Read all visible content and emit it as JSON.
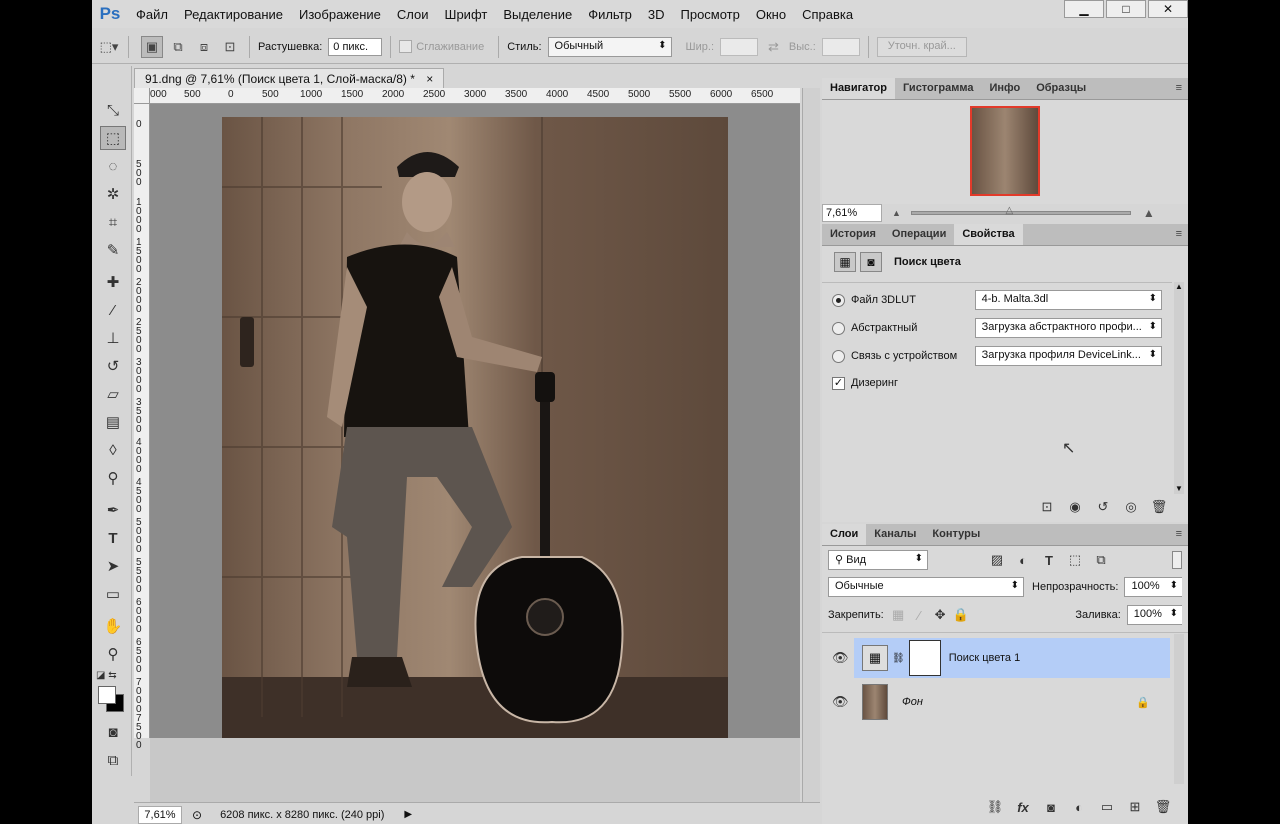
{
  "app": {
    "logo": "Ps"
  },
  "menu": [
    "Файл",
    "Редактирование",
    "Изображение",
    "Слои",
    "Шрифт",
    "Выделение",
    "Фильтр",
    "3D",
    "Просмотр",
    "Окно",
    "Справка"
  ],
  "window_controls": [
    "▁",
    "□",
    "✕"
  ],
  "options": {
    "feather_label": "Растушевка:",
    "feather_value": "0 пикс.",
    "antialias_label": "Сглаживание",
    "style_label": "Стиль:",
    "style_value": "Обычный",
    "width_label": "Шир.:",
    "height_label": "Выс.:",
    "refine_button": "Уточн. край..."
  },
  "document": {
    "tab_title": "91.dng @ 7,61% (Поиск цвета 1, Слой-маска/8) *",
    "close": "×",
    "ruler_h": [
      "000",
      "500",
      "0",
      "500",
      "1000",
      "1500",
      "2000",
      "2500",
      "3000",
      "3500",
      "4000",
      "4500",
      "5000",
      "5500",
      "6000",
      "6500"
    ],
    "ruler_v": [
      "0",
      "500",
      "1000",
      "1500",
      "2000",
      "2500",
      "3000",
      "3500",
      "4000",
      "4500",
      "5000",
      "5500",
      "6000",
      "6500",
      "7000",
      "7500"
    ],
    "zoom": "7,61%",
    "doc_info": "6208 пикс. x 8280 пикс. (240 ppi)"
  },
  "navigator": {
    "tabs": [
      "Навигатор",
      "Гистограмма",
      "Инфо",
      "Образцы"
    ],
    "zoom": "7,61%",
    "zoom_fraction": 0.45
  },
  "properties": {
    "tabs": [
      "История",
      "Операции",
      "Свойства"
    ],
    "title": "Поиск цвета",
    "options": [
      {
        "label": "Файл 3DLUT",
        "value": "4-b. Malta.3dl",
        "selected": true
      },
      {
        "label": "Абстрактный",
        "value": "Загрузка абстрактного профи...",
        "selected": false
      },
      {
        "label": "Связь с устройством",
        "value": "Загрузка профиля DeviceLink...",
        "selected": false
      }
    ],
    "dither_label": "Дизеринг",
    "dither_checked": true
  },
  "layers": {
    "tabs": [
      "Слои",
      "Каналы",
      "Контуры"
    ],
    "filter_kind": "Вид",
    "blend_mode": "Обычные",
    "opacity_label": "Непрозрачность:",
    "opacity_value": "100%",
    "lock_label": "Закрепить:",
    "fill_label": "Заливка:",
    "fill_value": "100%",
    "items": [
      {
        "name": "Поиск цвета 1",
        "selected": true
      },
      {
        "name": "Фон",
        "selected": false
      }
    ]
  },
  "colors": {
    "selection": "#b4cdf7",
    "sepia_dark": "#5f4a3c",
    "sepia_light": "#9c8571",
    "ui_bg": "#d6d6d6"
  }
}
